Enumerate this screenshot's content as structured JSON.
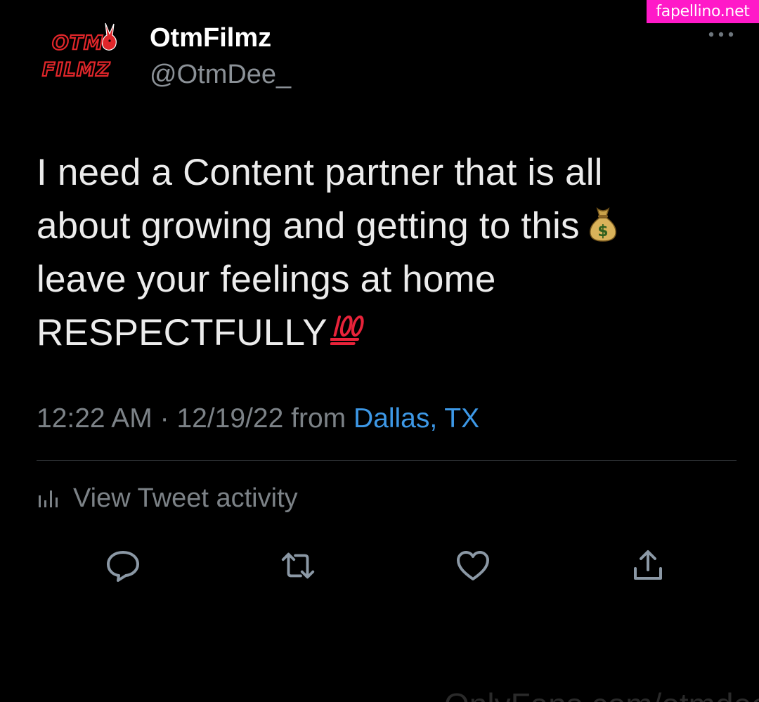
{
  "watermark": {
    "site": "fapellino.net",
    "footer": "OnlyFans.com/otmdee"
  },
  "profile": {
    "display_name": "OtmFilmz",
    "handle": "@OtmDee_",
    "avatar_text_1": "OTM",
    "avatar_text_2": "FILMZ"
  },
  "tweet": {
    "lines": [
      "I need a Content partner that is all",
      "about growing and getting to this",
      "leave your feelings at home",
      "RESPECTFULLY"
    ],
    "emojis": [
      "money-bag",
      "hundred-points"
    ],
    "time": "12:22 AM",
    "separator": "·",
    "date": "12/19/22",
    "from_label": "from",
    "location": "Dallas, TX"
  },
  "activity": {
    "label": "View Tweet activity"
  },
  "actions": [
    "reply-icon",
    "retweet-icon",
    "like-icon",
    "share-icon"
  ],
  "colors": {
    "background": "#000000",
    "accent_link": "#3d98e6",
    "muted_text": "#7c8287",
    "watermark_bg": "#ff19c8",
    "avatar_red": "#e0262a"
  }
}
